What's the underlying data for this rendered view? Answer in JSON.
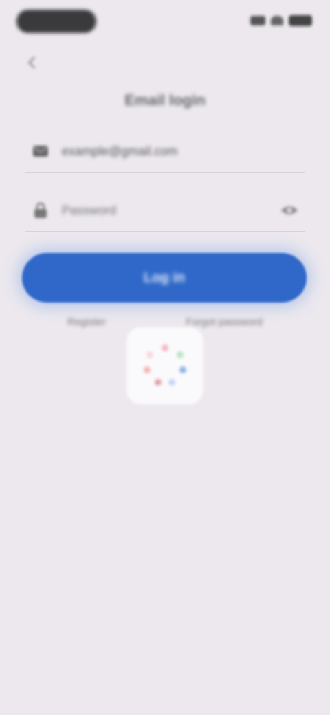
{
  "header": {
    "title": "Email login"
  },
  "form": {
    "email_value": "example@gmail.com",
    "password_placeholder": "Password"
  },
  "actions": {
    "login_label": "Log in",
    "register_link": "Register",
    "forgot_link": "Forgot password"
  },
  "colors": {
    "background": "#ece8ee",
    "primary": "#2f68c8"
  },
  "icons": {
    "back": "back-arrow-icon",
    "email": "mail-icon",
    "password": "lock-icon",
    "visibility": "eye-icon",
    "loading": "spinner-icon"
  }
}
